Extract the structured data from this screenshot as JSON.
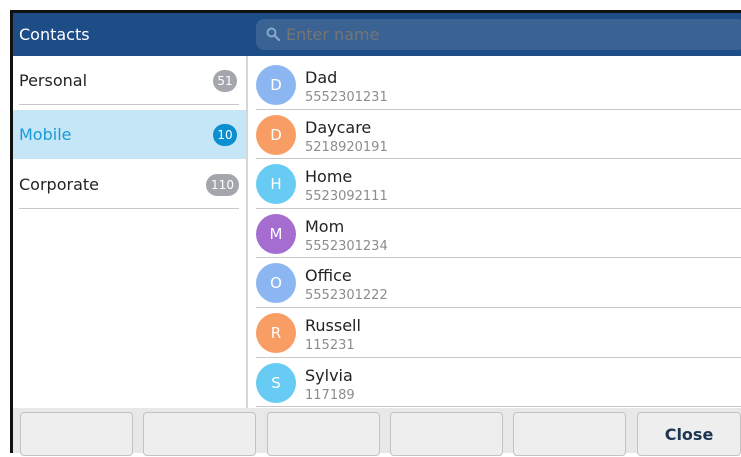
{
  "header": {
    "title": "Contacts",
    "search_placeholder": "Enter name"
  },
  "sidebar": {
    "items": [
      {
        "label": "Personal",
        "count": "51",
        "active": false
      },
      {
        "label": "Mobile",
        "count": "10",
        "active": true
      },
      {
        "label": "Corporate",
        "count": "110",
        "active": false
      }
    ]
  },
  "contacts": [
    {
      "initial": "D",
      "name": "Dad",
      "number": "5552301231",
      "color": "#8cb6f2"
    },
    {
      "initial": "D",
      "name": "Daycare",
      "number": "5218920191",
      "color": "#f89d64"
    },
    {
      "initial": "H",
      "name": "Home",
      "number": "5523092111",
      "color": "#67cbf3"
    },
    {
      "initial": "M",
      "name": "Mom",
      "number": "5552301234",
      "color": "#a46dcf"
    },
    {
      "initial": "O",
      "name": "Office",
      "number": "5552301222",
      "color": "#8cb6f2"
    },
    {
      "initial": "R",
      "name": "Russell",
      "number": "115231",
      "color": "#f89d64"
    },
    {
      "initial": "S",
      "name": "Sylvia",
      "number": "117189",
      "color": "#67cbf3"
    }
  ],
  "softkeys": {
    "k1": "",
    "k2": "",
    "k3": "",
    "k4": "",
    "k5": "",
    "close": "Close"
  },
  "colors": {
    "header_bg": "#1d4d86",
    "active_bg": "#c5e6f6",
    "active_text": "#1a9ad6",
    "badge_active": "#0b8fd0",
    "badge_default": "#a3a7ad"
  }
}
